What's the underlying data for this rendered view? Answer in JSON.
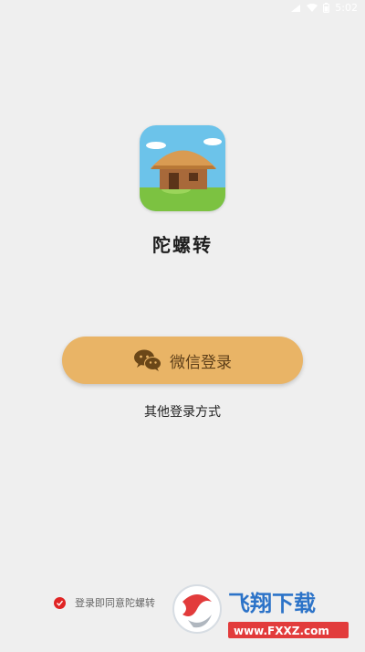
{
  "status_bar": {
    "time": "5:02"
  },
  "app": {
    "name": "陀螺转"
  },
  "login": {
    "wechat_label": "微信登录",
    "other_label": "其他登录方式"
  },
  "agreement": {
    "text": "登录即同意陀螺转"
  },
  "watermark": {
    "brand": "飞翔下载",
    "domain": "www.FXXZ.com"
  },
  "icons": [
    "wechat-icon",
    "app-house-icon",
    "checkbox-checked-icon",
    "wifi-icon",
    "signal-icon",
    "battery-icon"
  ],
  "colors": {
    "background": "#efefef",
    "button": "#e9b466",
    "button_text": "#5e3f19",
    "check": "#e02424"
  }
}
